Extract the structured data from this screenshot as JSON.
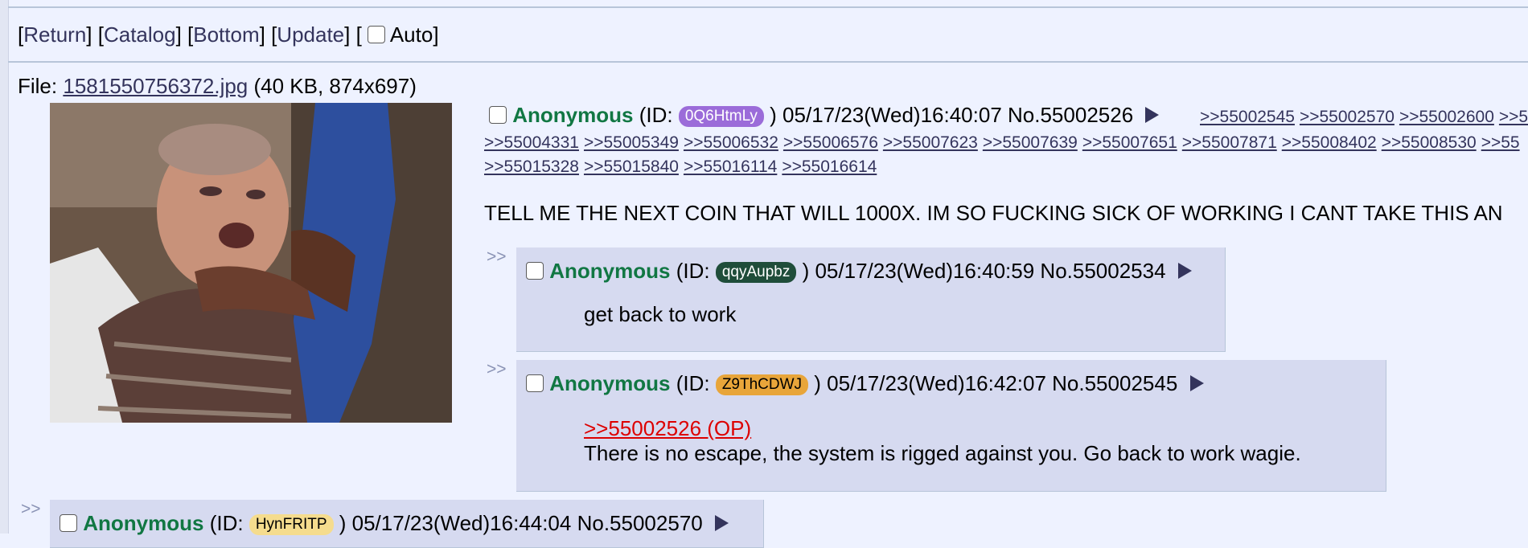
{
  "nav": {
    "return_label": "Return",
    "catalog_label": "Catalog",
    "bottom_label": "Bottom",
    "update_label": "Update",
    "auto_label": "Auto"
  },
  "file": {
    "prefix": "File:",
    "name": "1581550756372.jpg",
    "meta": "(40 KB, 874x697)"
  },
  "op": {
    "name": "Anonymous",
    "id_prefix": "(ID:",
    "id": "0Q6HtmLy",
    "id_color": "#9b6cd9",
    "datetime": ") 05/17/23(Wed)16:40:07",
    "post_no": "No.55002526",
    "backlinks_row1": [
      ">>55002545",
      ">>55002570",
      ">>55002600",
      ">>5"
    ],
    "backlinks_row2": [
      ">>55004331",
      ">>55005349",
      ">>55006532",
      ">>55006576",
      ">>55007623",
      ">>55007639",
      ">>55007651",
      ">>55007871",
      ">>55008402",
      ">>55008530",
      ">>55"
    ],
    "backlinks_row3": [
      ">>55015328",
      ">>55015840",
      ">>55016114",
      ">>55016614"
    ],
    "text": "TELL ME THE NEXT COIN THAT WILL 1000X. IM SO FUCKING SICK OF WORKING I CANT TAKE THIS AN"
  },
  "replies": [
    {
      "arrow": ">>",
      "name": "Anonymous",
      "id_prefix": "(ID:",
      "id": "qqyAupbz",
      "id_color": "#1f4d3a",
      "datetime": ") 05/17/23(Wed)16:40:59",
      "post_no": "No.55002534",
      "text": "get back to work"
    },
    {
      "arrow": ">>",
      "name": "Anonymous",
      "id_prefix": "(ID:",
      "id": "Z9ThCDWJ",
      "id_color": "#e8a53a",
      "datetime": ") 05/17/23(Wed)16:42:07",
      "post_no": "No.55002545",
      "quote": ">>55002526 (OP)",
      "text": "There is no escape, the system is rigged against you. Go back to work wagie."
    },
    {
      "arrow": ">>",
      "name": "Anonymous",
      "id_prefix": "(ID:",
      "id": "HynFRITP",
      "id_color": "#f5dc8e",
      "datetime": ") 05/17/23(Wed)16:44:04",
      "post_no": "No.55002570"
    }
  ]
}
